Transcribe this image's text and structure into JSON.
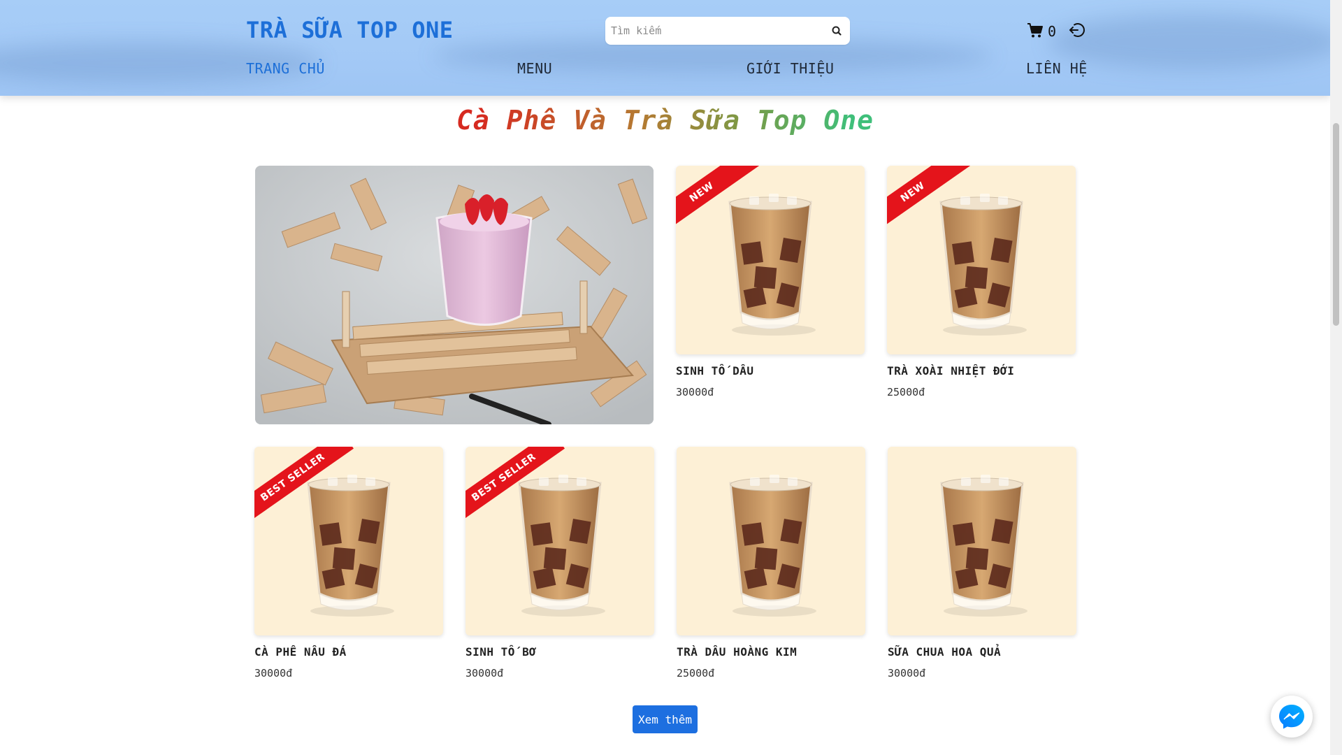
{
  "header": {
    "brand": "TRÀ SỮA TOP ONE",
    "search_placeholder": "Tìm kiếm",
    "search_icon": "search-icon",
    "cart_icon": "cart-icon",
    "cart_count": "0",
    "logout_icon": "logout-icon",
    "nav": [
      {
        "label": "TRANG CHỦ",
        "active": true
      },
      {
        "label": "MENU",
        "active": false
      },
      {
        "label": "GIỚI THIỆU",
        "active": false
      },
      {
        "label": "LIÊN HỆ",
        "active": false
      }
    ],
    "colors": {
      "background": "#a5cbf6",
      "brand": "#1d6fd8"
    }
  },
  "main": {
    "title": "Cà Phê Và Trà Sữa Top One",
    "title_gradient": [
      "#d62a20",
      "#b57a32",
      "#3fbf7a"
    ],
    "featured_image": "strawberry-smoothie-photo",
    "products": [
      {
        "name": "SINH TỐ DÂU",
        "price": "30000đ",
        "badge": "NEW"
      },
      {
        "name": "TRÀ XOÀI NHIỆT ĐỚI",
        "price": "25000đ",
        "badge": "NEW"
      },
      {
        "name": "CÀ PHÊ NÂU ĐÁ",
        "price": "30000đ",
        "badge": "BEST SELLER"
      },
      {
        "name": "SINH TỐ BƠ",
        "price": "30000đ",
        "badge": "BEST SELLER"
      },
      {
        "name": "TRÀ DÂU HOÀNG KIM",
        "price": "25000đ",
        "badge": ""
      },
      {
        "name": "SỮA CHUA HOA QUẢ",
        "price": "30000đ",
        "badge": ""
      }
    ],
    "more_button": "Xem thêm",
    "badge_color": "#e4141b",
    "button_color": "#1d6fe0"
  },
  "widgets": {
    "messenger_icon": "messenger-icon"
  }
}
